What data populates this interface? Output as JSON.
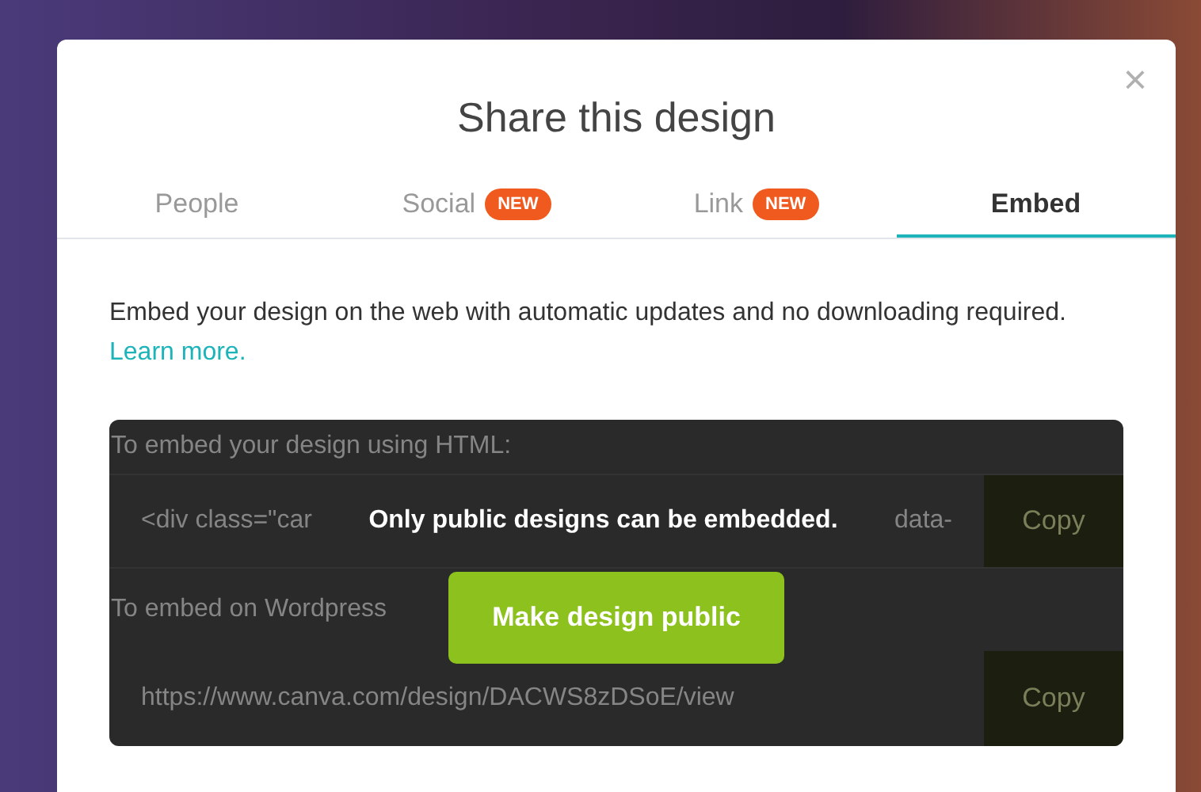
{
  "dialog": {
    "title": "Share this design",
    "close": "×"
  },
  "tabs": [
    {
      "label": "People",
      "selected": false
    },
    {
      "label": "Social",
      "badge": "NEW",
      "selected": false
    },
    {
      "label": "Link",
      "badge": "NEW",
      "selected": false
    },
    {
      "label": "Embed",
      "selected": true
    }
  ],
  "intro": {
    "text": "Embed your design on the web with automatic updates and no downloading required.",
    "link": "Learn more."
  },
  "embed_panel": {
    "html_label": "To embed your design using HTML:",
    "html_code_start": "<div class=\"car",
    "html_code_end": "data-",
    "html_copy": "Copy",
    "wordpress_label": "To embed on Wordpress",
    "wordpress_url": "https://www.canva.com/design/DACWS8zDSoE/view",
    "wordpress_copy": "Copy"
  },
  "overlay": {
    "message": "Only public designs can be embedded.",
    "button": "Make design public"
  }
}
